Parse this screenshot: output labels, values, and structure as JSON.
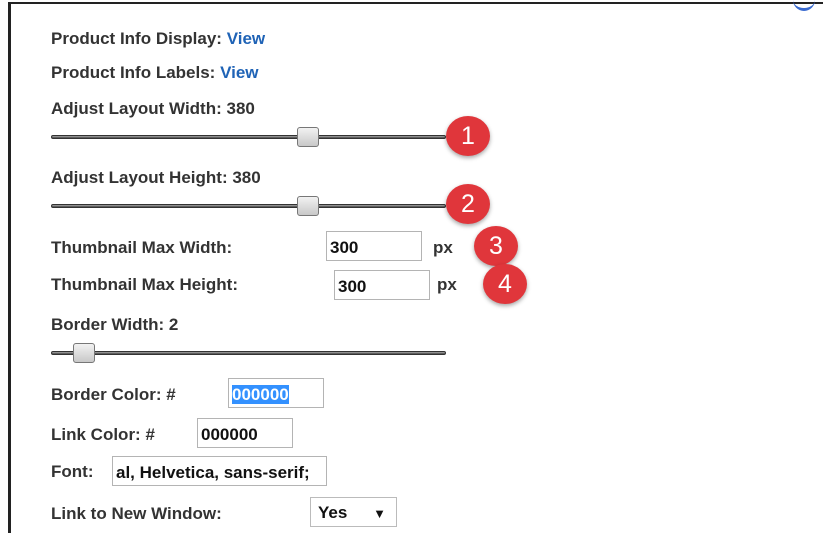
{
  "product_info_display": {
    "label": "Product Info Display:",
    "link": "View"
  },
  "product_info_labels": {
    "label": "Product Info Labels:",
    "link": "View"
  },
  "layout_width": {
    "label": "Adjust Layout Width: 380",
    "value_fraction": 0.66
  },
  "layout_height": {
    "label": "Adjust Layout Height: 380",
    "value_fraction": 0.66
  },
  "thumbnail_width": {
    "label": "Thumbnail Max Width:",
    "value": "300",
    "unit": "px"
  },
  "thumbnail_height": {
    "label": "Thumbnail Max Height:",
    "value": "300",
    "unit": "px"
  },
  "border_width": {
    "label": "Border Width: 2",
    "value_fraction": 0.06
  },
  "border_color": {
    "label": "Border Color: #",
    "value": "000000"
  },
  "link_color": {
    "label": "Link Color: #",
    "value": "000000"
  },
  "font": {
    "label": "Font:",
    "value": "al, Helvetica, sans-serif;"
  },
  "link_new_window": {
    "label": "Link to New Window:",
    "selected": "Yes"
  },
  "annotations": [
    "1",
    "2",
    "3",
    "4"
  ],
  "colors": {
    "badge": "#e0363b",
    "link": "#1f63b6",
    "selection": "#3391ff"
  }
}
